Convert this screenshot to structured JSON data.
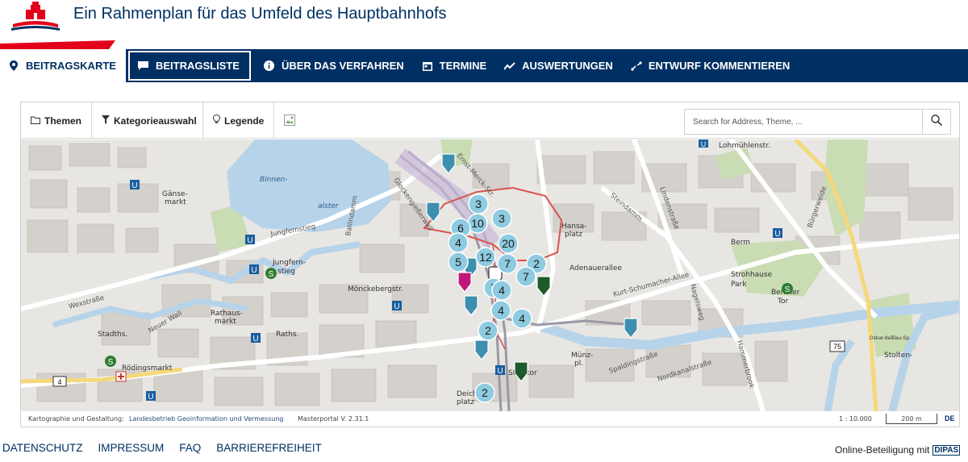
{
  "header": {
    "title": "Ein Rahmenplan für das Umfeld des Hauptbahnhofs"
  },
  "nav": {
    "items": [
      {
        "label": "BEITRAGSKARTE",
        "icon": "map-pin-icon"
      },
      {
        "label": "BEITRAGSLISTE",
        "icon": "comment-icon"
      },
      {
        "label": "ÜBER DAS VERFAHREN",
        "icon": "info-icon"
      },
      {
        "label": "TERMINE",
        "icon": "calendar-icon"
      },
      {
        "label": "AUSWERTUNGEN",
        "icon": "chart-line-icon"
      },
      {
        "label": "ENTWURF KOMMENTIEREN",
        "icon": "route-icon"
      }
    ]
  },
  "toolbar": {
    "themes_label": "Themen",
    "category_label": "Kategorieauswahl",
    "legend_label": "Legende",
    "search_placeholder": "Search for Address, Theme, ..."
  },
  "map": {
    "clusters": [
      3,
      10,
      3,
      6,
      20,
      4,
      12,
      2,
      5,
      7,
      7,
      7,
      4,
      4,
      4,
      2,
      2
    ],
    "labels": {
      "lake": "Binnen-",
      "lake2": "alster",
      "places": [
        "Jungfern-",
        "stieg",
        "Mönckebergstr.",
        "Rathaus-",
        "markt",
        "Rödingsmarkt",
        "Hansa-",
        "platz",
        "Adenauerallee",
        "Berliner",
        "Tor",
        "Strohhause",
        "Steintor",
        "Stadths.",
        "Lohmühlenstr.",
        "Gänse-",
        "markt",
        "Raths.",
        "Park",
        "Berm",
        "Münz-",
        "pl.",
        "Oskar-Keßlau-Sp.",
        "Stolten-",
        "Deich-",
        "platz"
      ],
      "roads": [
        "Ballindamm",
        "Glockengießerwall",
        "Steindamm",
        "Lindenstraße",
        "Kurt-Schumacher-Allee",
        "Nagelsweg",
        "Hammerbrook",
        "Spaldingstraße",
        "Nordkanalstraße",
        "Bürgerweide",
        "Jungfernstieg",
        "Neuer Wall",
        "Wexstraße",
        "Ernst-Merck-Str."
      ]
    },
    "highways": [
      "75",
      "4"
    ],
    "pin_colors": {
      "blue": "#3d8fb0",
      "magenta": "#c0187a",
      "green": "#1f5a2a",
      "white": "#ffffff",
      "cluster": "#8ecbe0"
    }
  },
  "map_footer": {
    "attr_label": "Kartographie und Gestaltung:",
    "attr_link": "Landesbetrieb Geoinformation und Vermessung",
    "masterportal": "Masterportal V. 2.31.1",
    "scale_ratio": "1 : 10.000",
    "scale_bar": "200 m",
    "lang": "DE"
  },
  "footer": {
    "links": [
      "DATENSCHUTZ",
      "IMPRESSUM",
      "FAQ",
      "BARRIEREFREIHEIT"
    ],
    "credit": "Online-Beteiligung mit",
    "logo_text": "DIPAS"
  },
  "colors": {
    "navy": "#003063",
    "red": "#e2001a"
  }
}
